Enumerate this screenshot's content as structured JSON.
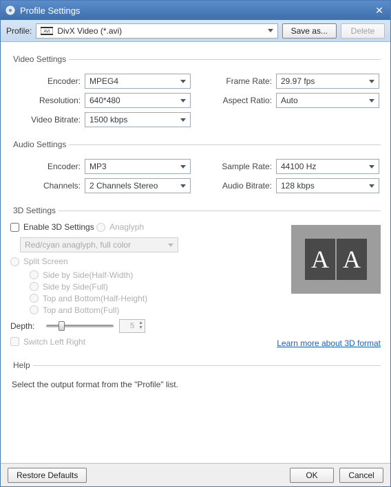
{
  "window": {
    "title": "Profile Settings"
  },
  "profilebar": {
    "label": "Profile:",
    "value": "DivX Video (*.avi)",
    "save_as": "Save as...",
    "delete": "Delete"
  },
  "video": {
    "legend": "Video Settings",
    "encoder_label": "Encoder:",
    "encoder_value": "MPEG4",
    "resolution_label": "Resolution:",
    "resolution_value": "640*480",
    "bitrate_label": "Video Bitrate:",
    "bitrate_value": "1500 kbps",
    "framerate_label": "Frame Rate:",
    "framerate_value": "29.97 fps",
    "aspect_label": "Aspect Ratio:",
    "aspect_value": "Auto"
  },
  "audio": {
    "legend": "Audio Settings",
    "encoder_label": "Encoder:",
    "encoder_value": "MP3",
    "channels_label": "Channels:",
    "channels_value": "2 Channels Stereo",
    "sample_label": "Sample Rate:",
    "sample_value": "44100 Hz",
    "bitrate_label": "Audio Bitrate:",
    "bitrate_value": "128 kbps"
  },
  "threeD": {
    "legend": "3D Settings",
    "enable": "Enable 3D Settings",
    "anaglyph": "Anaglyph",
    "anaglyph_mode": "Red/cyan anaglyph, full color",
    "split": "Split Screen",
    "sbs_half": "Side by Side(Half-Width)",
    "sbs_full": "Side by Side(Full)",
    "tab_half": "Top and Bottom(Half-Height)",
    "tab_full": "Top and Bottom(Full)",
    "depth_label": "Depth:",
    "depth_value": "5",
    "switch_lr": "Switch Left Right",
    "learn_more": "Learn more about 3D format",
    "preview_letter": "A"
  },
  "help": {
    "legend": "Help",
    "message": "Select the output format from the \"Profile\" list."
  },
  "footer": {
    "restore": "Restore Defaults",
    "ok": "OK",
    "cancel": "Cancel"
  }
}
